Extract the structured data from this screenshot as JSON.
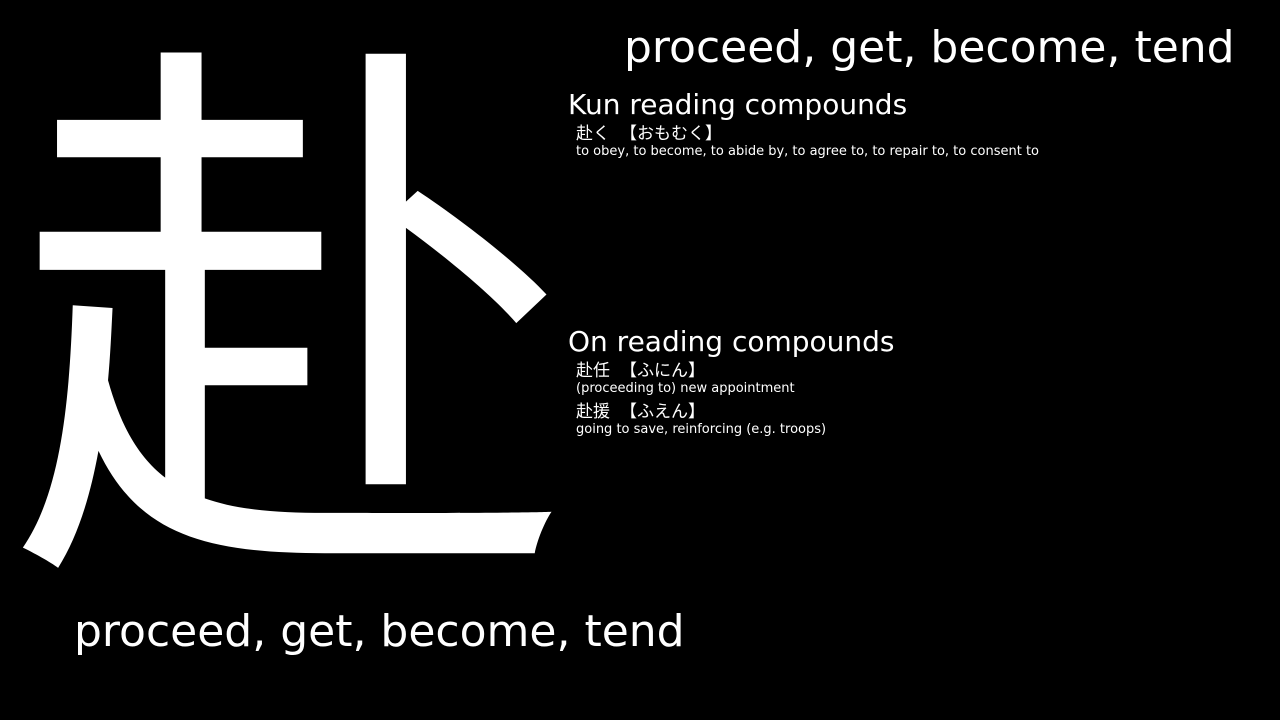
{
  "kanji": "赴",
  "meaning_top": "proceed, get, become, tend",
  "meaning_bottom": "proceed, get, become, tend",
  "kun": {
    "title": "Kun reading compounds",
    "items": [
      {
        "word": "赴く",
        "reading": "【おもむく】",
        "gloss": "to obey, to become, to abide by, to agree to, to repair to, to consent to"
      }
    ]
  },
  "on": {
    "title": "On reading compounds",
    "items": [
      {
        "word": "赴任",
        "reading": "【ふにん】",
        "gloss": "(proceeding to) new appointment"
      },
      {
        "word": "赴援",
        "reading": "【ふえん】",
        "gloss": "going to save, reinforcing (e.g. troops)"
      }
    ]
  }
}
